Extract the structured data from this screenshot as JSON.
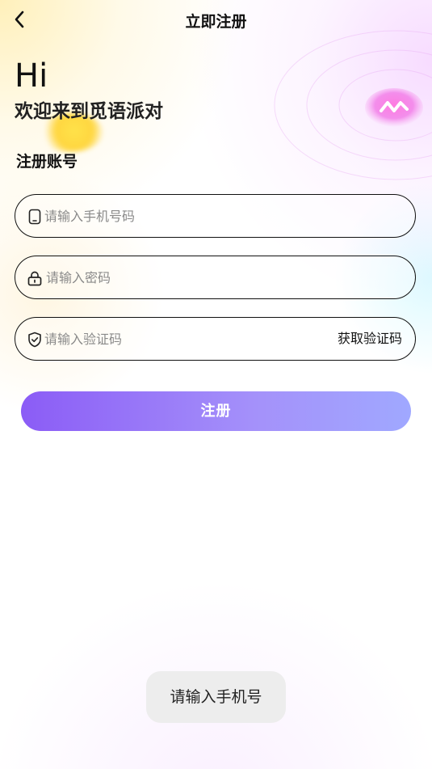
{
  "header": {
    "title": "立即注册",
    "back_icon": "chevron-left-icon"
  },
  "hero": {
    "greeting": "Hi",
    "welcome": "欢迎来到觅语派对"
  },
  "form": {
    "section_title": "注册账号",
    "phone": {
      "placeholder": "请输入手机号码",
      "value": "",
      "icon": "phone-icon"
    },
    "password": {
      "placeholder": "请输入密码",
      "value": "",
      "icon": "lock-icon"
    },
    "code": {
      "placeholder": "请输入验证码",
      "value": "",
      "icon": "shield-check-icon",
      "get_code_label": "获取验证码"
    },
    "submit_label": "注册"
  },
  "toast": {
    "message": "请输入手机号"
  },
  "colors": {
    "button_gradient_start": "#8b5cf6",
    "button_gradient_end": "#a0a8ff",
    "text": "#111111",
    "toast_bg": "#ededed"
  }
}
